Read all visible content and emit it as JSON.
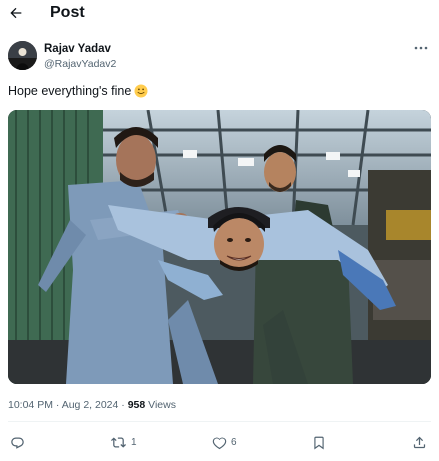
{
  "header": {
    "back_icon": "arrow-left-icon",
    "title": "Post"
  },
  "post": {
    "author": {
      "display_name": "Rajav Yadav",
      "handle": "@RajavYadav2"
    },
    "more_icon": "more-dots-icon",
    "text": "Hope everything's fine",
    "emoji": "slightly-smiling-face",
    "meta": {
      "time": "10:04 PM",
      "separator": "·",
      "date": "Aug 2, 2024",
      "views_count": "958",
      "views_label": "Views"
    },
    "actions": {
      "reply_icon": "reply-icon",
      "repost_icon": "repost-icon",
      "repost_count": "1",
      "like_icon": "heart-icon",
      "like_count": "6",
      "bookmark_icon": "bookmark-icon",
      "share_icon": "share-icon"
    }
  },
  "colors": {
    "text_primary": "#0f1419",
    "text_secondary": "#536471",
    "divider": "#eff3f4"
  }
}
